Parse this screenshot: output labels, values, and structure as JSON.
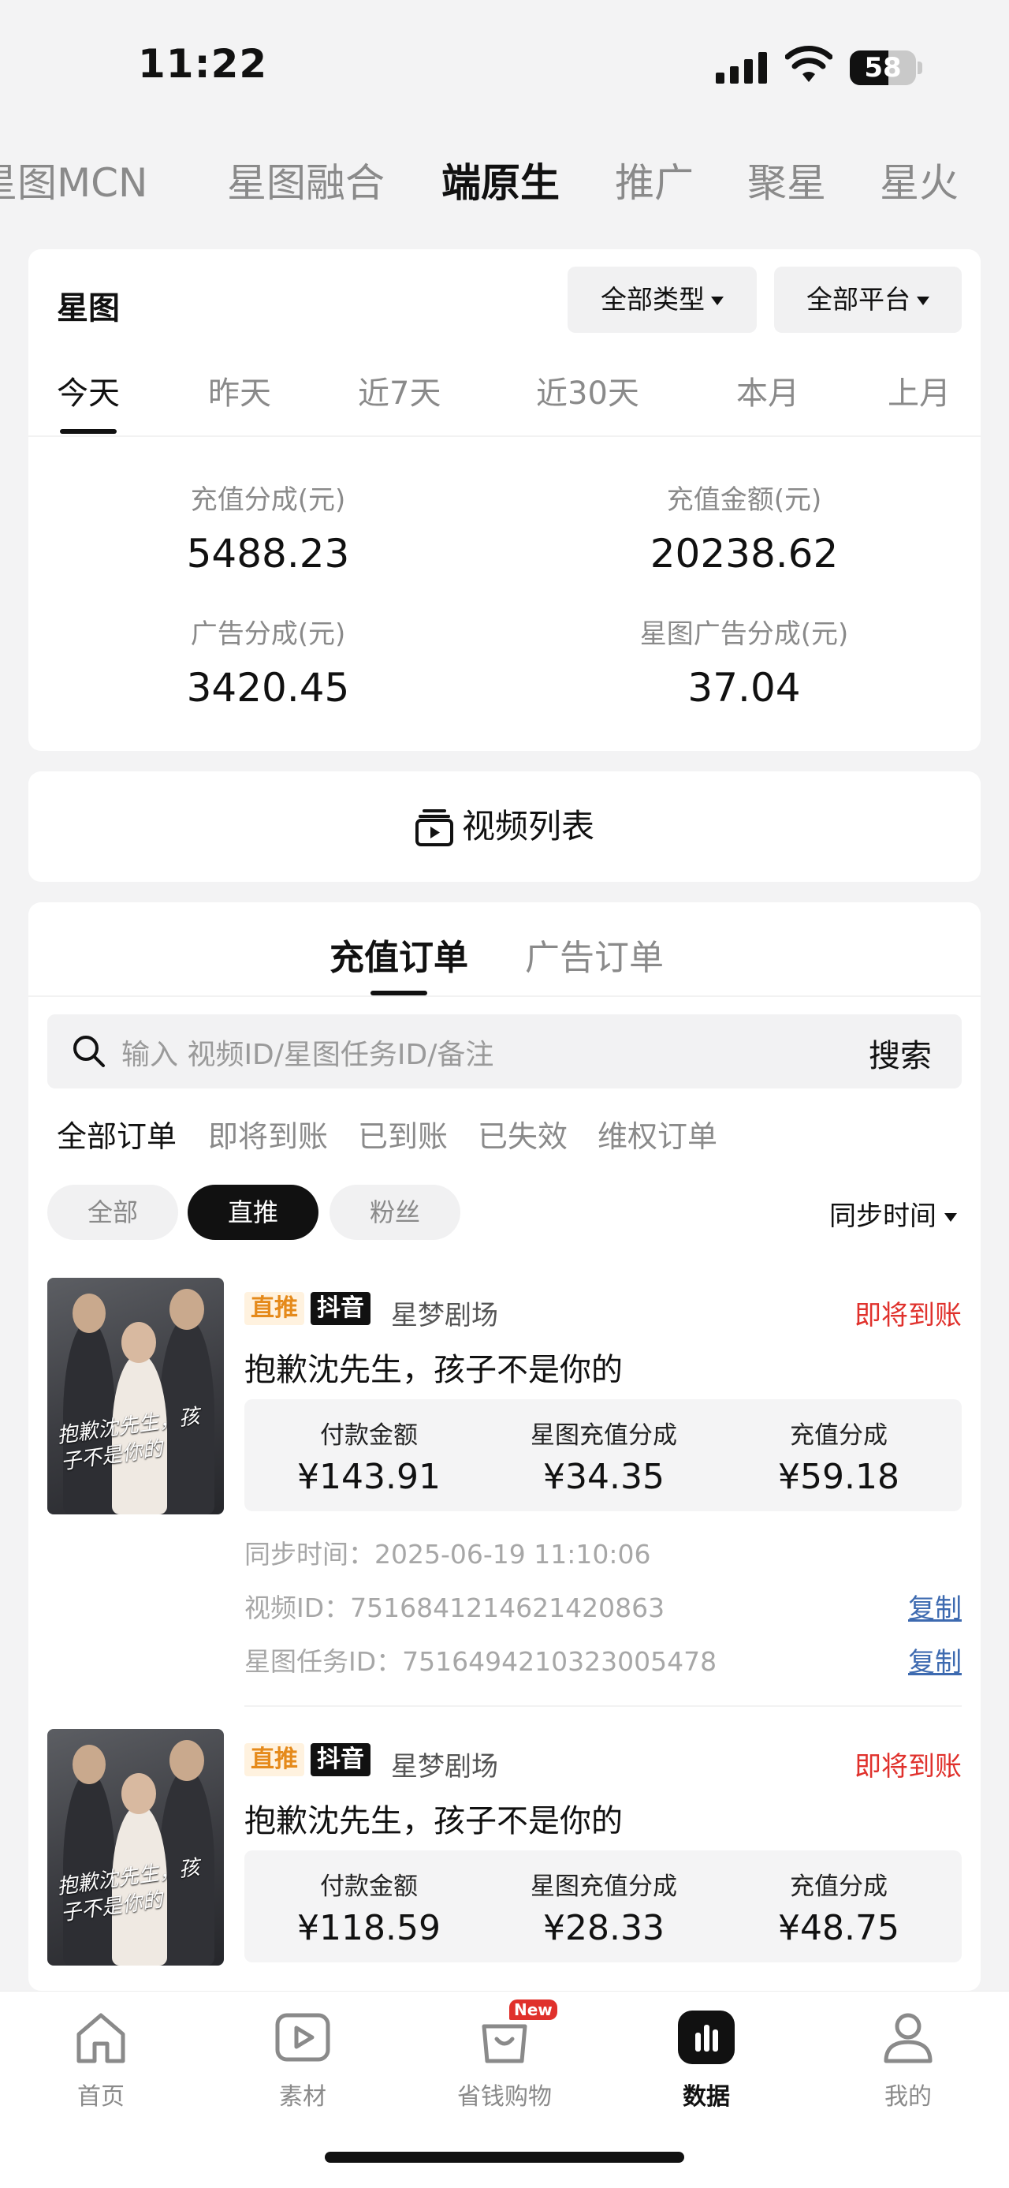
{
  "status_bar": {
    "time": "11:22",
    "battery": "58",
    "battery_level": 0.58
  },
  "category_tabs": [
    {
      "label": "星图MCN",
      "active": false
    },
    {
      "label": "星图融合",
      "active": false
    },
    {
      "label": "端原生",
      "active": true
    },
    {
      "label": "推广",
      "active": false
    },
    {
      "label": "聚星",
      "active": false
    },
    {
      "label": "星火",
      "active": false
    }
  ],
  "stats": {
    "title": "星图",
    "type_filter": "全部类型",
    "platform_filter": "全部平台",
    "periods": [
      "今天",
      "昨天",
      "近7天",
      "近30天",
      "本月",
      "上月"
    ],
    "active_period": "今天",
    "metrics": [
      {
        "label": "充值分成(元)",
        "value": "5488.23"
      },
      {
        "label": "充值金额(元)",
        "value": "20238.62"
      },
      {
        "label": "广告分成(元)",
        "value": "3420.45"
      },
      {
        "label": "星图广告分成(元)",
        "value": "37.04"
      }
    ]
  },
  "video_list": {
    "label": "视频列表"
  },
  "orders": {
    "tabs": [
      {
        "label": "充值订单",
        "active": true
      },
      {
        "label": "广告订单",
        "active": false
      }
    ],
    "search": {
      "placeholder": "输入 视频ID/星图任务ID/备注",
      "button": "搜索"
    },
    "filters": [
      "全部订单",
      "即将到账",
      "已到账",
      "已失效",
      "维权订单"
    ],
    "chips": [
      {
        "label": "全部",
        "active": false
      },
      {
        "label": "直推",
        "active": true
      },
      {
        "label": "粉丝",
        "active": false
      }
    ],
    "sort_label": "同步时间",
    "items": [
      {
        "tag_direct": "直推",
        "tag_platform": "抖音",
        "source": "星梦剧场",
        "status": "即将到账",
        "title": "抱歉沈先生，孩子不是你的",
        "poster_text": "抱歉沈先生，孩子不是你的",
        "pay_label": "付款金额",
        "pay": "¥143.91",
        "xt_label": "星图充值分成",
        "xt": "¥34.35",
        "cz_label": "充值分成",
        "cz": "¥59.18",
        "sync": "同步时间：2025-06-19 11:10:06",
        "video_id": "视频ID：7516841214621420863",
        "task_id": "星图任务ID：7516494210323005478",
        "copy": "复制"
      },
      {
        "tag_direct": "直推",
        "tag_platform": "抖音",
        "source": "星梦剧场",
        "status": "即将到账",
        "title": "抱歉沈先生，孩子不是你的",
        "poster_text": "抱歉沈先生，孩子不是你的",
        "pay_label": "付款金额",
        "pay": "¥118.59",
        "xt_label": "星图充值分成",
        "xt": "¥28.33",
        "cz_label": "充值分成",
        "cz": "¥48.75"
      }
    ]
  },
  "bottom_nav": [
    {
      "label": "首页",
      "icon": "home-icon",
      "active": false
    },
    {
      "label": "素材",
      "icon": "play-icon",
      "active": false
    },
    {
      "label": "省钱购物",
      "icon": "shopping-bag-icon",
      "active": false,
      "badge": "New"
    },
    {
      "label": "数据",
      "icon": "bar-chart-icon",
      "active": true
    },
    {
      "label": "我的",
      "icon": "user-icon",
      "active": false
    }
  ],
  "colors": {
    "accent_red": "#e0312c",
    "tag_orange": "#e58a1b",
    "link_blue": "#3d6ab0"
  }
}
